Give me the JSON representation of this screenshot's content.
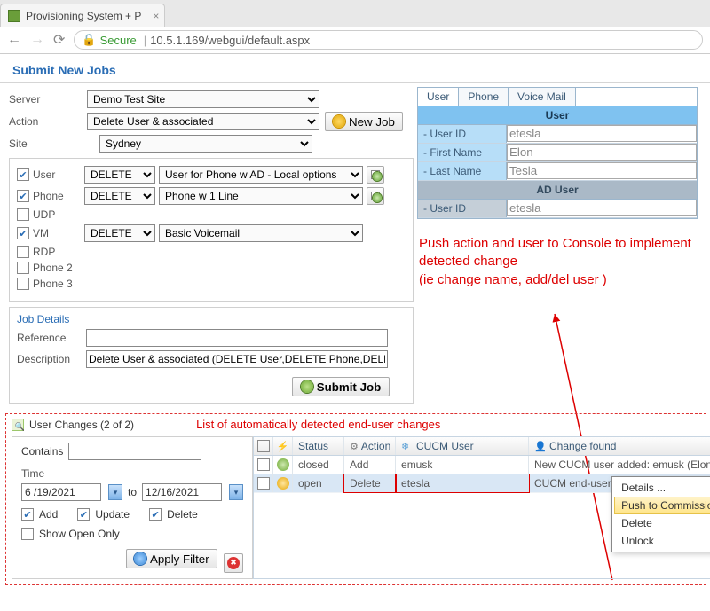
{
  "browser": {
    "tab_title": "Provisioning System + P",
    "secure_label": "Secure",
    "url": "10.5.1.169/webgui/default.aspx"
  },
  "panel_title": "Submit New Jobs",
  "form": {
    "server_label": "Server",
    "server_value": "Demo Test Site",
    "action_label": "Action",
    "action_value": "Delete User & associated",
    "new_job_label": "New Job",
    "site_label": "Site",
    "site_value": "Sydney"
  },
  "components": {
    "user": {
      "label": "User",
      "checked": true,
      "op": "DELETE",
      "tmpl": "User for Phone w AD - Local options"
    },
    "phone": {
      "label": "Phone",
      "checked": true,
      "op": "DELETE",
      "tmpl": "Phone w 1 Line"
    },
    "udp": {
      "label": "UDP",
      "checked": false
    },
    "vm": {
      "label": "VM",
      "checked": true,
      "op": "DELETE",
      "tmpl": "Basic Voicemail"
    },
    "rdp": {
      "label": "RDP",
      "checked": false
    },
    "phone2": {
      "label": "Phone 2",
      "checked": false
    },
    "phone3": {
      "label": "Phone 3",
      "checked": false
    }
  },
  "job": {
    "heading": "Job Details",
    "ref_label": "Reference",
    "ref_value": "",
    "desc_label": "Description",
    "desc_value": "Delete User & associated (DELETE User,DELETE Phone,DELETE Voice Ma",
    "submit_label": "Submit Job"
  },
  "right": {
    "tabs": {
      "user": "User",
      "phone": "Phone",
      "vm": "Voice Mail"
    },
    "sec_user": "User",
    "userid_label": "- User ID",
    "userid_value": "etesla",
    "fname_label": "- First Name",
    "fname_value": "Elon",
    "lname_label": "- Last Name",
    "lname_value": "Tesla",
    "sec_ad": "AD User",
    "ad_userid_label": "- User ID",
    "ad_userid_value": "etesla"
  },
  "annotation": {
    "text": "Push action and user to Console to implement detected change\n(ie change name, add/del user )",
    "caption": "List of automatically detected end-user changes"
  },
  "changes": {
    "title": "User Changes (2 of 2)",
    "contains_label": "Contains",
    "contains_value": "",
    "time_label": "Time",
    "date_from": "6 /19/2021",
    "to_label": "to",
    "date_to": "12/16/2021",
    "add_label": "Add",
    "update_label": "Update",
    "delete_label": "Delete",
    "show_open_label": "Show Open Only",
    "apply_label": "Apply Filter",
    "headers": {
      "status": "Status",
      "action": "Action",
      "cucm": "CUCM User",
      "change": "Change found"
    },
    "rows": [
      {
        "state": "closed",
        "status": "closed",
        "action": "Add",
        "user": "emusk",
        "change": "New CUCM user added: emusk (Elon Musk)"
      },
      {
        "state": "open",
        "status": "open",
        "action": "Delete",
        "user": "etesla",
        "change": "CUCM end-user 'etesla' re-activated (was in"
      }
    ],
    "ctx": {
      "details": "Details ...",
      "push": "Push to Commissioning",
      "delete": "Delete",
      "unlock": "Unlock"
    }
  }
}
